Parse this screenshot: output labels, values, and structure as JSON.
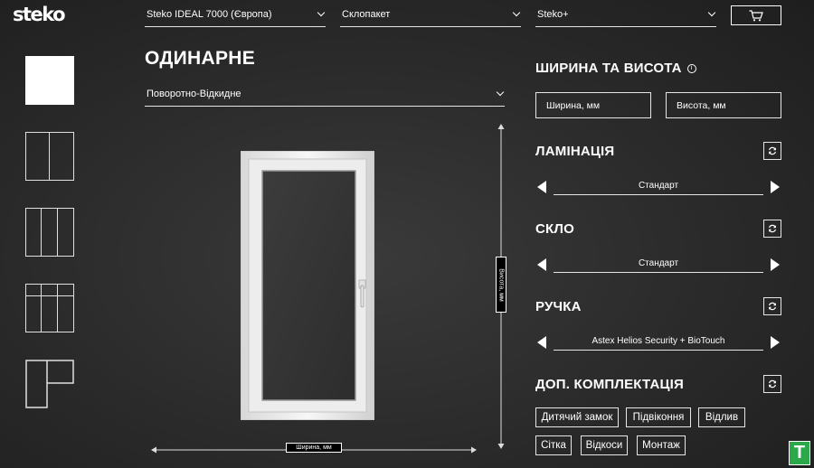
{
  "brand": {
    "logo_text": "steko"
  },
  "header": {
    "profile_select": "Steko IDEAL 7000 (Європа)",
    "glass_select": "Склопакет",
    "fittings_select": "Steko+",
    "cart_icon": "cart-icon"
  },
  "sidebar": {
    "items": [
      {
        "type": "single",
        "active": true
      },
      {
        "type": "double",
        "active": false
      },
      {
        "type": "triple",
        "active": false
      },
      {
        "type": "triple-transom",
        "active": false
      },
      {
        "type": "door-window",
        "active": false
      }
    ]
  },
  "main": {
    "title": "ОДИНАРНЕ",
    "opening_select": "Поворотно-Відкидне",
    "width_label": "Ширина, мм",
    "height_label": "Висота, мм"
  },
  "panel": {
    "size": {
      "title": "ШИРИНА ТА ВИСОТА",
      "info_icon": "i",
      "width_placeholder": "Ширина, мм",
      "height_placeholder": "Висота, мм"
    },
    "lamination": {
      "title": "ЛАМІНАЦІЯ",
      "value": "Стандарт"
    },
    "glass": {
      "title": "СКЛО",
      "value": "Стандарт"
    },
    "handle": {
      "title": "РУЧКА",
      "value": "Astex Helios Security + BioTouch"
    },
    "extras": {
      "title": "ДОП. КОМПЛЕКТАЦІЯ",
      "chips": [
        "Дитячий замок",
        "Підвіконня",
        "Відлив",
        "Сітка",
        "Відкоси",
        "Монтаж"
      ]
    }
  },
  "badge": {
    "letter": "T",
    "color": "#2aa84a"
  }
}
